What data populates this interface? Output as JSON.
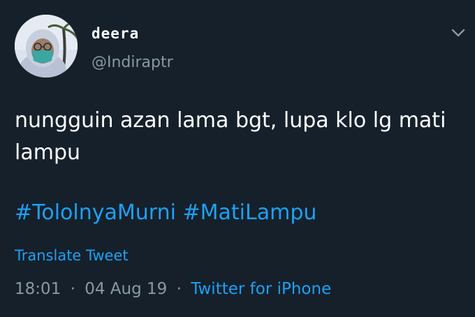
{
  "user": {
    "display_name": "deera",
    "handle": "@Indiraptr"
  },
  "tweet": {
    "text": "nungguin azan lama bgt, lupa klo lg mati lampu",
    "hashtags": [
      "#TololnyaMurni",
      "#MatiLampu"
    ],
    "translate_label": "Translate Tweet",
    "time": "18:01",
    "date": "04 Aug 19",
    "separator": "·",
    "source": "Twitter for iPhone"
  },
  "icons": {
    "menu": "chevron-down-icon"
  },
  "colors": {
    "background": "#15202b",
    "accent": "#1da1f2",
    "secondary_text": "#8899a6",
    "primary_text": "#ffffff"
  }
}
